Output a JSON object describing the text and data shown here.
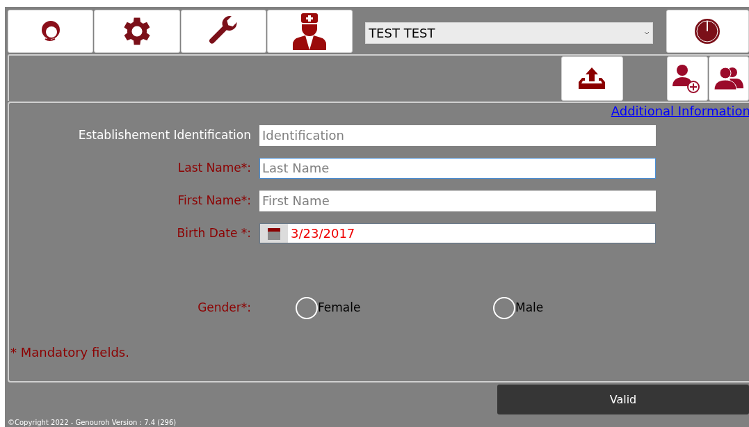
{
  "toolbar": {
    "buttons": [
      {
        "kind": "support"
      },
      {
        "kind": "settings"
      },
      {
        "kind": "tools"
      },
      {
        "kind": "doctor"
      }
    ],
    "patient_select": {
      "value": "TEST TEST"
    },
    "power": {
      "kind": "power"
    }
  },
  "actions": [
    {
      "kind": "upload"
    },
    {
      "kind": "add-user"
    },
    {
      "kind": "users"
    }
  ],
  "form": {
    "link": "Additional Information",
    "fields": [
      {
        "label": "Establishement Identification",
        "required": false,
        "kind": "text",
        "placeholder": "Identification",
        "focused": false
      },
      {
        "label": "Last Name*:",
        "required": true,
        "kind": "text",
        "placeholder": "Last Name",
        "focused": true
      },
      {
        "label": "First Name*:",
        "required": true,
        "kind": "text",
        "placeholder": "First Name",
        "focused": false
      },
      {
        "label": "Birth Date *:",
        "required": true,
        "kind": "date",
        "value": "3/23/2017",
        "focused": false
      }
    ],
    "gender": {
      "label": "Gender*:",
      "options": [
        {
          "label": "Female",
          "selected": false
        },
        {
          "label": "Male",
          "selected": false
        }
      ]
    },
    "note": "* Mandatory fields."
  },
  "valid_button": "Valid",
  "footer": "©Copyright 2022 - Genouroh  Version : 7.4 (296)"
}
